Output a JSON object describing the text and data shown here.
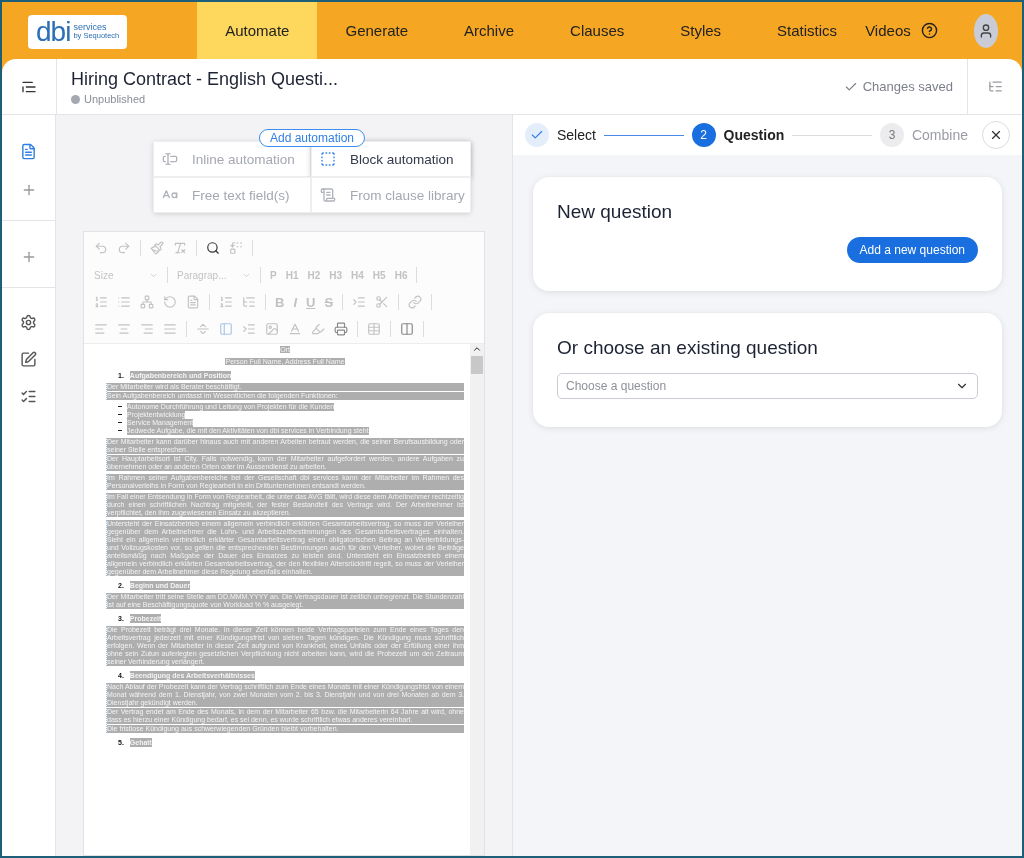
{
  "header": {
    "logo": {
      "mark": "dbi",
      "line1": "services",
      "line2": "by Sequotech"
    },
    "nav": [
      {
        "label": "Automate",
        "selected": true
      },
      {
        "label": "Generate",
        "selected": false
      },
      {
        "label": "Archive",
        "selected": false
      },
      {
        "label": "Clauses",
        "selected": false
      },
      {
        "label": "Styles",
        "selected": false
      },
      {
        "label": "Statistics",
        "selected": false
      }
    ],
    "videos": "Videos"
  },
  "title_bar": {
    "title": "Hiring Contract - English Questi...",
    "status": "Unpublished",
    "saved": "Changes saved"
  },
  "automation": {
    "button": "Add automation",
    "options": [
      {
        "label": "Inline automation",
        "selected": false
      },
      {
        "label": "Block automation",
        "selected": true
      },
      {
        "label": "Free text field(s)",
        "selected": false
      },
      {
        "label": "From clause library",
        "selected": false
      }
    ]
  },
  "toolbar": {
    "size": "Size",
    "paragraph": "Paragrap...",
    "headings": [
      "P",
      "H1",
      "H2",
      "H3",
      "H4",
      "H5",
      "H6"
    ],
    "formats": [
      "B",
      "I",
      "U",
      "S"
    ]
  },
  "document": [
    {
      "kind": "center",
      "text": "Ort"
    },
    {
      "kind": "center",
      "text": "Person Full Name, Address Full Name"
    },
    {
      "kind": "heading",
      "number": "1.",
      "text": "Aufgabenbereich und Position"
    },
    {
      "kind": "para",
      "lines": [
        "Der Mitarbeiter wird als Berater beschäftigt.",
        "Sein Aufgabenbereich umfasst im Wesentlichen die folgenden Funktionen:"
      ]
    },
    {
      "kind": "bullets",
      "items": [
        "Autonome Durchführung und Leitung von Projekten für die Kunden",
        "Projektentwicklung",
        "Service Management",
        "Jedwede Aufgabe, die mit den Aktivitäten von dbi services in Verbindung steht"
      ]
    },
    {
      "kind": "para",
      "lines": [
        "Der Mitarbeiter kann darüber hinaus auch mit anderen Arbeiten betraut werden, die seiner Berufsausbildung oder seiner Stelle entsprechen.",
        "Der Hauptarbeitsort ist City. Falls notwendig, kann der Mitarbeiter aufgefordert werden, andere Aufgaben zu übernehmen oder an anderen Orten oder im Aussendienst zu arbeiten."
      ]
    },
    {
      "kind": "para",
      "lines": [
        "Im Rahmen seiner Aufgabenbereiche bei der Gesellschaft dbi services kann der Mitarbeiter im Rahmen des Personalverleihs in Form von Regiearbeit in ein Drittunternehmen entsandt werden."
      ]
    },
    {
      "kind": "para",
      "lines": [
        "Im Fall einer Entsendung in Form von Regiearbeit, die unter das AVG fällt, wird diese dem Arbeitnehmer rechtzeitig durch einen schriftlichen Nachtrag mitgeteilt, der fester Bestandteil des Vertrags wird. Der Arbeitnehmer ist verpflichtet, den ihm zugewiesenen Einsatz zu akzeptieren."
      ]
    },
    {
      "kind": "para",
      "lines": [
        "Untersteht der Einsatzbetrieb einem allgemein verbindlich erklärten Gesamtarbeitsvertrag, so muss der Verleiher gegenüber dem Arbeitnehmer die Lohn- und Arbeitszeitbestimmungen des Gesamtarbeitsvertrages einhalten. Sieht ein allgemein verbindlich erklärter Gesamtarbeitsvertrag einen obligatorischen Beitrag an Weiterbildungs- und Vollzugskosten vor, so gelten die entsprechenden Bestimmungen auch für den Verleiher, wobei die Beiträge anteilsmäßig nach Maßgabe der Dauer des Einsatzes zu leisten sind. Untersteht ein Einsatzbetrieb einem allgemein verbindlich erklärten Gesamtarbeitsvertrag, der den flexiblen Altersrücktritt regelt, so muss der Verleiher gegenüber dem Arbeitnehmer diese Regelung ebenfalls einhalten."
      ]
    },
    {
      "kind": "heading",
      "number": "2.",
      "text": "Beginn und Dauer"
    },
    {
      "kind": "para",
      "lines": [
        "Der Mitarbeiter tritt seine Stelle am DD.MMM.YYYY an. Die Vertragsdauer ist zeitlich unbegrenzt. Die Stundenzahl ist auf eine Beschäftigungsquote von Workload % % ausgelegt."
      ]
    },
    {
      "kind": "heading",
      "number": "3.",
      "text": "Probezeit"
    },
    {
      "kind": "para",
      "lines": [
        "Die Probezeit beträgt drei Monate. In dieser Zeit können beide Vertragsparteien zum Ende eines Tages den Arbeitsvertrag jederzeit mit einer Kündigungsfrist von sieben Tagen kündigen. Die Kündigung muss schriftlich erfolgen. Wenn der Mitarbeiter in dieser Zeit aufgrund von Krankheit, eines Unfalls oder der Erfüllung einer ihm ohne sein Zutun auferlegten gesetzlichen Verpflichtung nicht arbeiten kann, wird die Probezeit um den Zeitraum seiner Verhinderung verlängert."
      ]
    },
    {
      "kind": "heading",
      "number": "4.",
      "text": "Beendigung des Arbeitsverhältnisses"
    },
    {
      "kind": "para",
      "lines": [
        "Nach Ablauf der Probezeit kann der Vertrag schriftlich zum Ende eines Monats mit einer Kündigungsfrist von einem Monat während dem 1. Dienstjahr, von zwei Monaten vom 2. bis 3. Dienstjahr und von drei Monaten ab dem 3. Dienstjahr gekündigt werden.",
        "Der Vertrag endet am Ende des Monats, in dem der Mitarbeiter 65 bzw. die Mitarbeiterin 64 Jahre alt wird, ohne dass es hierzu einer Kündigung bedarf, es sei denn, es wurde schriftlich etwas anderes vereinbart.",
        "Die fristlose Kündigung aus schwerwiegenden Gründen bleibt vorbehalten."
      ]
    },
    {
      "kind": "heading",
      "number": "5.",
      "text": "Gehalt"
    }
  ],
  "stepper": [
    {
      "label": "Select",
      "done": true,
      "selected": false
    },
    {
      "number": "2",
      "label": "Question",
      "done": false,
      "selected": true
    },
    {
      "number": "3",
      "label": "Combine",
      "done": false,
      "selected": false
    }
  ],
  "new_question": {
    "title": "New question",
    "button": "Add a new question"
  },
  "existing_question": {
    "title": "Or choose an existing question",
    "placeholder": "Choose a question"
  }
}
